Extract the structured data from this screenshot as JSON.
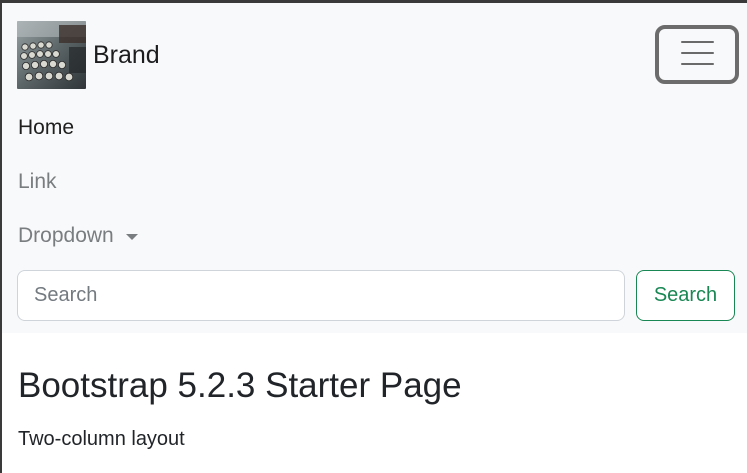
{
  "navbar": {
    "brand": {
      "text": "Brand",
      "logo_icon": "typewriter-photo-icon"
    },
    "toggler_icon": "hamburger-menu-icon",
    "items": [
      {
        "label": "Home",
        "active": true
      },
      {
        "label": "Link",
        "active": false
      },
      {
        "label": "Dropdown",
        "active": false,
        "dropdown_icon": "caret-down-icon"
      }
    ],
    "search": {
      "placeholder": "Search",
      "value": "",
      "button_label": "Search"
    }
  },
  "colors": {
    "navbar_background": "#f8f9fa",
    "success": "#198754",
    "muted_text": "#7a7d80",
    "body_text": "#212529"
  },
  "main": {
    "title": "Bootstrap 5.2.3 Starter Page",
    "subtitle": "Two-column layout"
  }
}
